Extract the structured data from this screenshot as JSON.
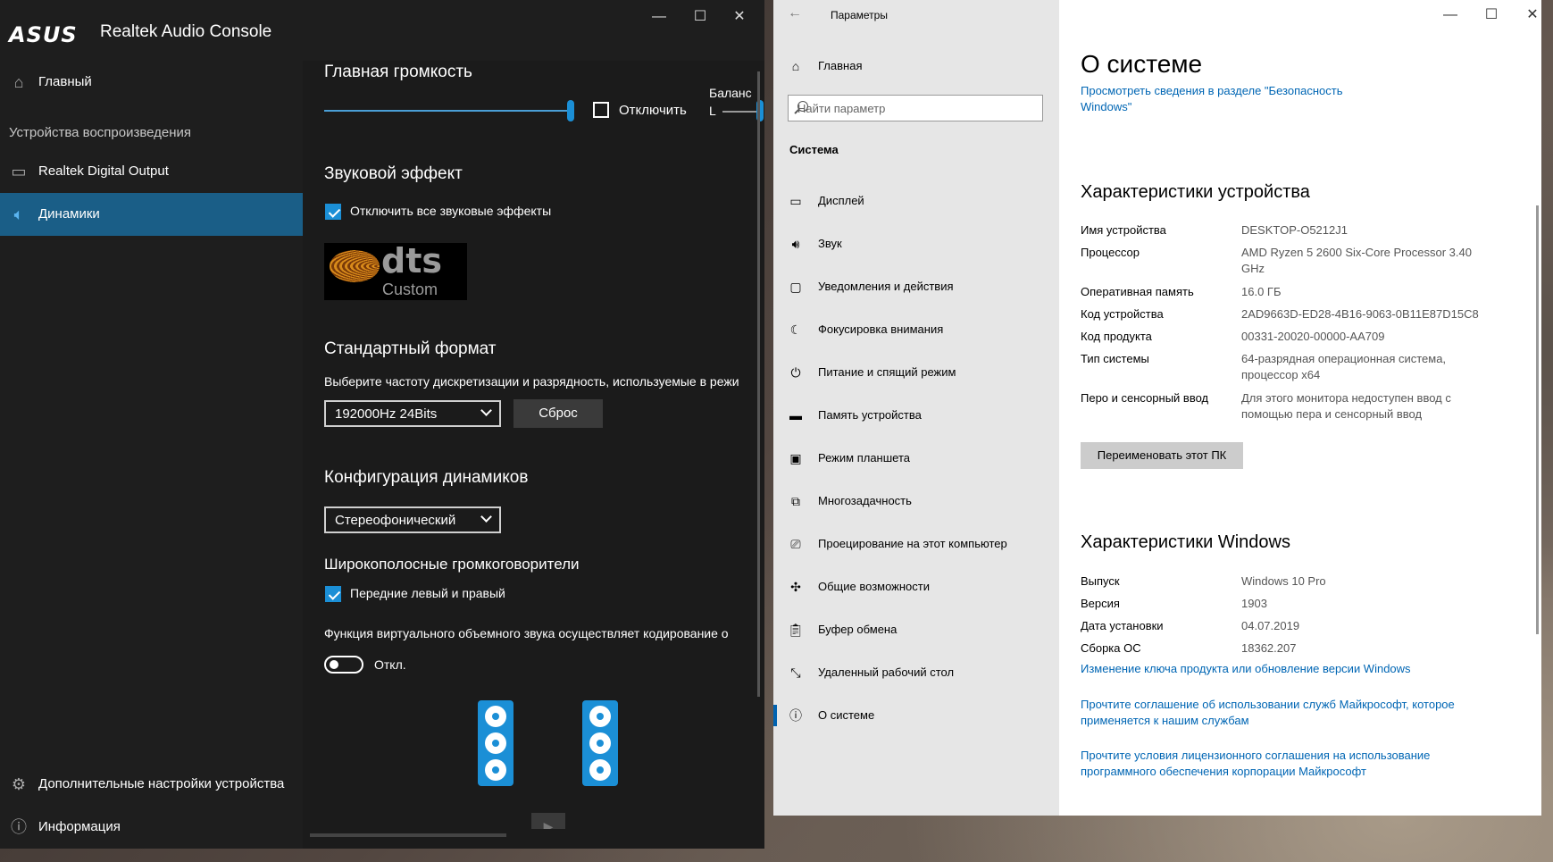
{
  "realtek": {
    "brand": "ASUS",
    "title": "Realtek Audio Console",
    "window_controls": {
      "minimize": "—",
      "maximize": "☐",
      "close": "✕"
    },
    "sidebar": {
      "home": "Главный",
      "section": "Устройства воспроизведения",
      "devices": [
        "Realtek Digital Output",
        "Динамики"
      ],
      "advanced": "Дополнительные настройки устройства",
      "info": "Информация"
    },
    "main": {
      "volume_title": "Главная громкость",
      "mute_label": "Отключить",
      "balance_label": "Баланс",
      "balance_left": "L",
      "volume_percent": 100,
      "effect_title": "Звуковой эффект",
      "disable_effects_label": "Отключить все звуковые эффекты",
      "dts_word": "dts",
      "dts_custom": "Custom",
      "format_title": "Стандартный формат",
      "format_desc": "Выберите частоту дискретизации и разрядность, используемые в режи",
      "format_value": "192000Hz 24Bits",
      "reset_button": "Сброс",
      "config_title": "Конфигурация динамиков",
      "config_value": "Стереофонический",
      "fullrange_title": "Широкополосные громкоговорители",
      "front_lr_label": "Передние левый и правый",
      "virtual_surround_desc": "Функция виртуального объемного звука осуществляет кодирование о",
      "toggle_state": "Откл."
    },
    "colors": {
      "accent": "#1b8fd6",
      "sidebar_active": "#1a5e87"
    }
  },
  "settings": {
    "title": "Параметры",
    "window_controls": {
      "minimize": "—",
      "maximize": "☐",
      "close": "✕"
    },
    "nav": {
      "home": "Главная",
      "search_placeholder": "Найти параметр",
      "group": "Система",
      "items": [
        {
          "label": "Дисплей",
          "icon": "display-icon"
        },
        {
          "label": "Звук",
          "icon": "sound-icon"
        },
        {
          "label": "Уведомления и действия",
          "icon": "notification-icon"
        },
        {
          "label": "Фокусировка внимания",
          "icon": "focus-icon"
        },
        {
          "label": "Питание и спящий режим",
          "icon": "power-icon"
        },
        {
          "label": "Память устройства",
          "icon": "storage-icon"
        },
        {
          "label": "Режим планшета",
          "icon": "tablet-icon"
        },
        {
          "label": "Многозадачность",
          "icon": "multitask-icon"
        },
        {
          "label": "Проецирование на этот компьютер",
          "icon": "project-icon"
        },
        {
          "label": "Общие возможности",
          "icon": "shared-icon"
        },
        {
          "label": "Буфер обмена",
          "icon": "clipboard-icon"
        },
        {
          "label": "Удаленный рабочий стол",
          "icon": "remote-icon"
        },
        {
          "label": "О системе",
          "icon": "info-icon"
        }
      ]
    },
    "content": {
      "title": "О системе",
      "security_link": "Просмотреть сведения в разделе \"Безопасность Windows\"",
      "device_specs_title": "Характеристики устройства",
      "device_specs": [
        {
          "k": "Имя устройства",
          "v": "DESKTOP-O5212J1"
        },
        {
          "k": "Процессор",
          "v": "AMD Ryzen 5 2600 Six-Core Processor 3.40 GHz"
        },
        {
          "k": "Оперативная память",
          "v": "16.0 ГБ"
        },
        {
          "k": "Код устройства",
          "v": "2AD9663D-ED28-4B16-9063-0B11E87D15C8"
        },
        {
          "k": "Код продукта",
          "v": "00331-20020-00000-AA709"
        },
        {
          "k": "Тип системы",
          "v": "64-разрядная операционная система, процессор x64"
        },
        {
          "k": "Перо и сенсорный ввод",
          "v": "Для этого монитора недоступен ввод с помощью пера и сенсорный ввод"
        }
      ],
      "rename_button": "Переименовать этот ПК",
      "windows_specs_title": "Характеристики Windows",
      "windows_specs": [
        {
          "k": "Выпуск",
          "v": "Windows 10 Pro"
        },
        {
          "k": "Версия",
          "v": "1903"
        },
        {
          "k": "Дата установки",
          "v": "04.07.2019"
        },
        {
          "k": "Сборка ОС",
          "v": "18362.207"
        }
      ],
      "links": [
        "Изменение ключа продукта или обновление версии Windows",
        "Прочтите соглашение об использовании служб Майкрософт, которое применяется к нашим службам",
        "Прочтите условия лицензионного соглашения на использование программного обеспечения корпорации Майкрософт"
      ]
    },
    "colors": {
      "link": "#0066b4",
      "nav_bg": "#e6e6e6",
      "selected_marker": "#0063b1"
    }
  }
}
